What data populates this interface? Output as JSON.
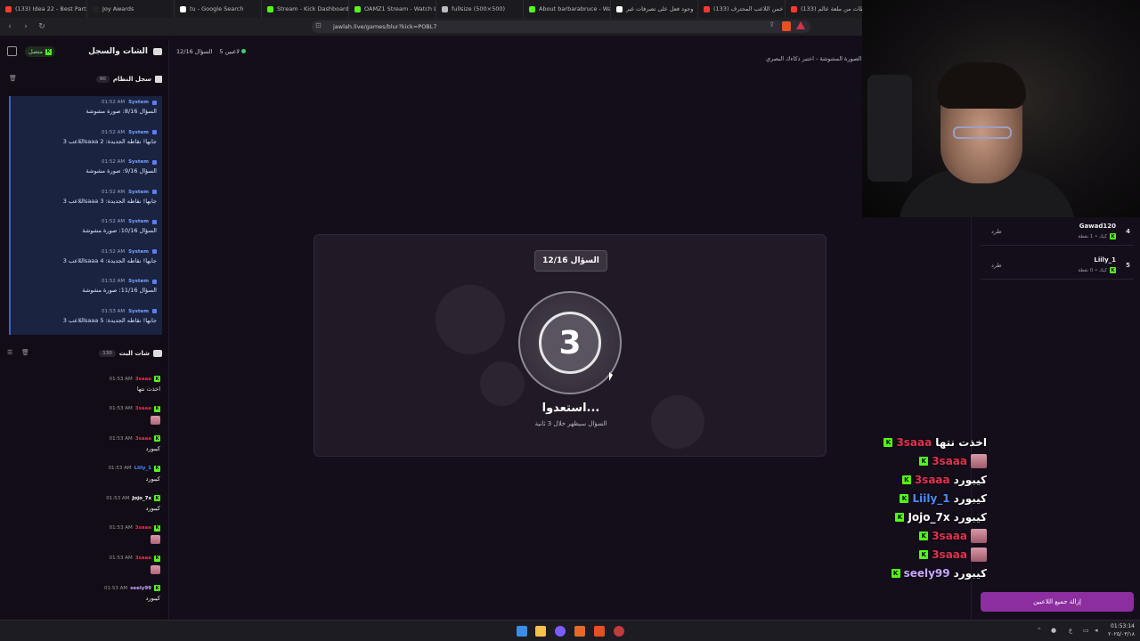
{
  "browser": {
    "tabs": [
      {
        "label": "(133) Idea 22 - Best Part (",
        "color": "#ff3b30"
      },
      {
        "label": "Joy Awards",
        "color": "#222"
      },
      {
        "label": "tu - Google Search",
        "color": "#ffffff"
      },
      {
        "label": "Stream - Kick Dashboard",
        "color": "#53fc18"
      },
      {
        "label": "OAMZ1 Stream - Watch Li",
        "color": "#53fc18"
      },
      {
        "label": "fullsize (500×500)",
        "color": "#bbbbbb"
      },
      {
        "label": "About barbarabruce - Wat",
        "color": "#53fc18"
      },
      {
        "label": "وجود فعل على تصرفات غير",
        "color": "#ffffff"
      },
      {
        "label": "(133) خمن اللاعب المحترف",
        "color": "#ff3b30"
      },
      {
        "label": "(133) لحظات من ملعة عالم",
        "color": "#ff3b30"
      }
    ],
    "url": "jawlah.live/games/blur?kick=POBL7",
    "back_icon": "chevron-left-icon",
    "forward_icon": "chevron-right-icon",
    "reload_icon": "reload-icon"
  },
  "left_panel": {
    "title": "الشات والسجل",
    "status": "متصل",
    "system_log": {
      "title": "سجل النظام",
      "count": "90",
      "entries": [
        {
          "time": "01:52 AM",
          "sender": "System",
          "text": "السؤال 8/16: صورة مشوشة"
        },
        {
          "time": "01:52 AM",
          "sender": "System",
          "text": "اللاعب 3saaa جابها! نقاطه الجديدة: 2"
        },
        {
          "time": "01:52 AM",
          "sender": "System",
          "text": "السؤال 9/16: صورة مشوشة"
        },
        {
          "time": "01:52 AM",
          "sender": "System",
          "text": "اللاعب 3saaa جابها! نقاطه الجديدة: 3"
        },
        {
          "time": "01:52 AM",
          "sender": "System",
          "text": "السؤال 10/16: صورة مشوشة"
        },
        {
          "time": "01:52 AM",
          "sender": "System",
          "text": "اللاعب 3saaa جابها! نقاطه الجديدة: 4"
        },
        {
          "time": "01:52 AM",
          "sender": "System",
          "text": "السؤال 11/16: صورة مشوشة"
        },
        {
          "time": "01:53 AM",
          "sender": "System",
          "text": "اللاعب 3saaa جابها! نقاطه الجديدة: 5"
        }
      ]
    },
    "stream_chat": {
      "title": "شات البث",
      "count": "130",
      "messages": [
        {
          "time": "01:53 AM",
          "user": "3saaa",
          "color": "#e0334f",
          "text": "اخذت نتها",
          "emote": false
        },
        {
          "time": "01:53 AM",
          "user": "3saaa",
          "color": "#e0334f",
          "text": "",
          "emote": true
        },
        {
          "time": "01:53 AM",
          "user": "3saaa",
          "color": "#e0334f",
          "text": "كيبورد",
          "emote": false
        },
        {
          "time": "01:53 AM",
          "user": "Liily_1",
          "color": "#4a8cff",
          "text": "كيبورد",
          "emote": false
        },
        {
          "time": "01:53 AM",
          "user": "Jojo_7x",
          "color": "#ffffff",
          "text": "كيبورد",
          "emote": false
        },
        {
          "time": "01:53 AM",
          "user": "3saaa",
          "color": "#e0334f",
          "text": "",
          "emote": true
        },
        {
          "time": "01:53 AM",
          "user": "3saaa",
          "color": "#e0334f",
          "text": "",
          "emote": true
        },
        {
          "time": "01:53 AM",
          "user": "seely99",
          "color": "#c9a6ff",
          "text": "كيبورد",
          "emote": false
        }
      ]
    }
  },
  "main": {
    "question_progress": "السؤال 12/16",
    "player_count": "5 لاعبين",
    "game_subtitle": "الصورة المشوشة - اختبر ذكاءك البصري!",
    "question_badge": "السؤال 12/16",
    "countdown": "3",
    "ready_text": "استعدوا...",
    "appear_text": "السؤال سيظهر خلال 3 ثانية"
  },
  "right_panel": {
    "players": [
      {
        "rank": "4",
        "name": "Gawad120",
        "sub": "كيك • 1 نقطة",
        "kick_label": "طرد"
      },
      {
        "rank": "5",
        "name": "Liily_1",
        "sub": "كيك • 0 نقطة",
        "kick_label": "طرد"
      }
    ],
    "clear_button": "إزالة جميع اللاعبين"
  },
  "overlay_chat": [
    {
      "user": "3saaa",
      "color": "#e0334f",
      "text": "اخذت نتها",
      "emote": false
    },
    {
      "user": "3saaa",
      "color": "#e0334f",
      "text": "",
      "emote": true
    },
    {
      "user": "3saaa",
      "color": "#e0334f",
      "text": "كيبورد",
      "emote": false
    },
    {
      "user": "Liily_1",
      "color": "#4a8cff",
      "text": "كيبورد",
      "emote": false
    },
    {
      "user": "Jojo_7x",
      "color": "#ffffff",
      "text": "كيبورد",
      "emote": false
    },
    {
      "user": "3saaa",
      "color": "#e0334f",
      "text": "",
      "emote": true
    },
    {
      "user": "3saaa",
      "color": "#e0334f",
      "text": "",
      "emote": true
    },
    {
      "user": "seely99",
      "color": "#c9a6ff",
      "text": "كيبورد",
      "emote": false
    }
  ],
  "taskbar": {
    "time": "01:53:14",
    "date": "٢٠٢٥/٠٣/١٨",
    "lang": "ع"
  }
}
